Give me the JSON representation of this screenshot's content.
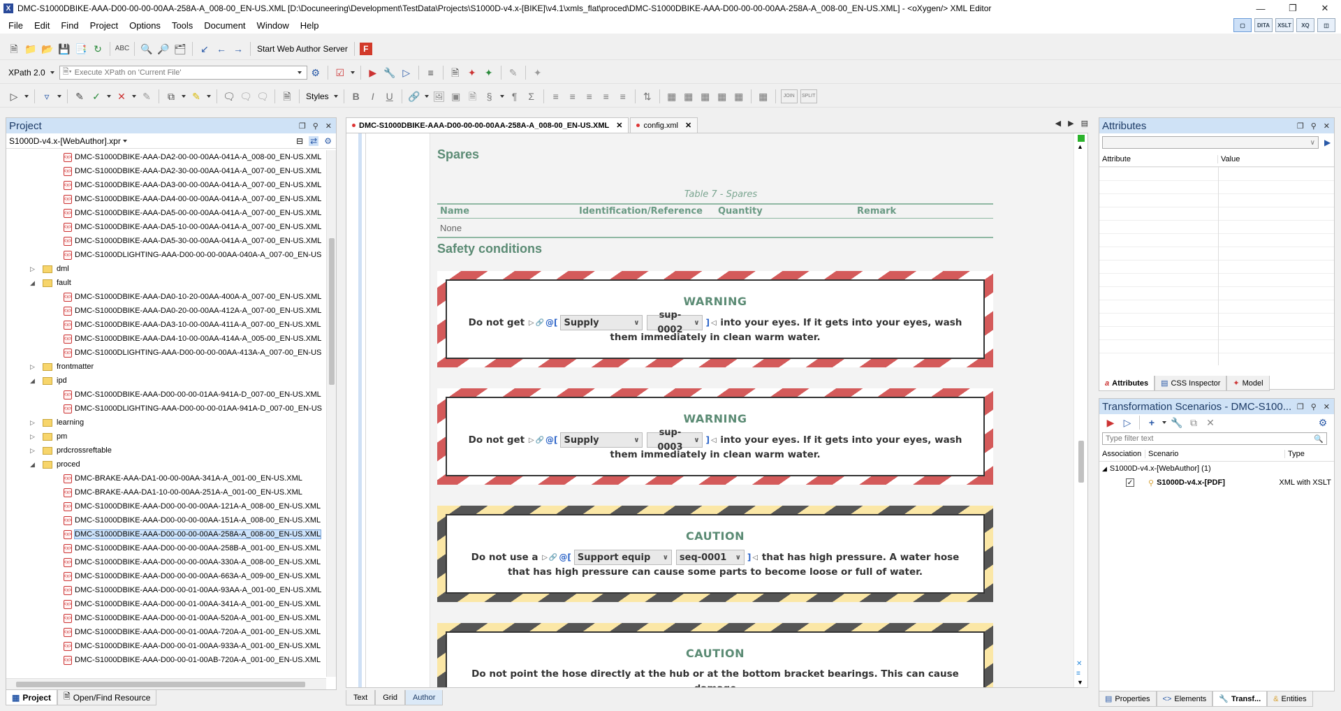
{
  "window": {
    "title": "DMC-S1000DBIKE-AAA-D00-00-00-00AA-258A-A_008-00_EN-US.XML [D:\\Docuneering\\Development\\TestData\\Projects\\S1000D-v4.x-[BIKE]\\v4.1\\xmls_flat\\proced\\DMC-S1000DBIKE-AAA-D00-00-00-00AA-258A-A_008-00_EN-US.XML] - <oXygen/> XML Editor"
  },
  "menu": [
    "File",
    "Edit",
    "Find",
    "Project",
    "Options",
    "Tools",
    "Document",
    "Window",
    "Help"
  ],
  "perspectives": [
    "DITA",
    "XSLT",
    "XQ"
  ],
  "toolbar1": {
    "web_author": "Start Web Author Server"
  },
  "toolbar2": {
    "xpath_version": "XPath 2.0",
    "xpath_placeholder": "Execute XPath on 'Current File'"
  },
  "toolbar3": {
    "styles": "Styles",
    "join": "JOIN",
    "split": "SPLIT"
  },
  "project": {
    "title": "Project",
    "file": "S1000D-v4.x-[WebAuthor].xpr",
    "rows": [
      {
        "type": "file",
        "level": 2,
        "label": "DMC-S1000DBIKE-AAA-DA2-00-00-00AA-041A-A_008-00_EN-US.XML"
      },
      {
        "type": "file",
        "level": 2,
        "label": "DMC-S1000DBIKE-AAA-DA2-30-00-00AA-041A-A_007-00_EN-US.XML"
      },
      {
        "type": "file",
        "level": 2,
        "label": "DMC-S1000DBIKE-AAA-DA3-00-00-00AA-041A-A_007-00_EN-US.XML"
      },
      {
        "type": "file",
        "level": 2,
        "label": "DMC-S1000DBIKE-AAA-DA4-00-00-00AA-041A-A_007-00_EN-US.XML"
      },
      {
        "type": "file",
        "level": 2,
        "label": "DMC-S1000DBIKE-AAA-DA5-00-00-00AA-041A-A_007-00_EN-US.XML"
      },
      {
        "type": "file",
        "level": 2,
        "label": "DMC-S1000DBIKE-AAA-DA5-10-00-00AA-041A-A_007-00_EN-US.XML"
      },
      {
        "type": "file",
        "level": 2,
        "label": "DMC-S1000DBIKE-AAA-DA5-30-00-00AA-041A-A_007-00_EN-US.XML"
      },
      {
        "type": "file",
        "level": 2,
        "label": "DMC-S1000DLIGHTING-AAA-D00-00-00-00AA-040A-A_007-00_EN-US"
      },
      {
        "type": "folder",
        "level": 1,
        "label": "dml",
        "toggle": "▷"
      },
      {
        "type": "folder",
        "level": 1,
        "label": "fault",
        "toggle": "◢"
      },
      {
        "type": "file",
        "level": 2,
        "label": "DMC-S1000DBIKE-AAA-DA0-10-20-00AA-400A-A_007-00_EN-US.XML"
      },
      {
        "type": "file",
        "level": 2,
        "label": "DMC-S1000DBIKE-AAA-DA0-20-00-00AA-412A-A_007-00_EN-US.XML"
      },
      {
        "type": "file",
        "level": 2,
        "label": "DMC-S1000DBIKE-AAA-DA3-10-00-00AA-411A-A_007-00_EN-US.XML"
      },
      {
        "type": "file",
        "level": 2,
        "label": "DMC-S1000DBIKE-AAA-DA4-10-00-00AA-414A-A_005-00_EN-US.XML"
      },
      {
        "type": "file",
        "level": 2,
        "label": "DMC-S1000DLIGHTING-AAA-D00-00-00-00AA-413A-A_007-00_EN-US"
      },
      {
        "type": "folder",
        "level": 1,
        "label": "frontmatter",
        "toggle": "▷"
      },
      {
        "type": "folder",
        "level": 1,
        "label": "ipd",
        "toggle": "◢"
      },
      {
        "type": "file",
        "level": 2,
        "label": "DMC-S1000DBIKE-AAA-D00-00-00-01AA-941A-D_007-00_EN-US.XML"
      },
      {
        "type": "file",
        "level": 2,
        "label": "DMC-S1000DLIGHTING-AAA-D00-00-00-01AA-941A-D_007-00_EN-US"
      },
      {
        "type": "folder",
        "level": 1,
        "label": "learning",
        "toggle": "▷"
      },
      {
        "type": "folder",
        "level": 1,
        "label": "pm",
        "toggle": "▷"
      },
      {
        "type": "folder",
        "level": 1,
        "label": "prdcrossreftable",
        "toggle": "▷"
      },
      {
        "type": "folder",
        "level": 1,
        "label": "proced",
        "toggle": "◢"
      },
      {
        "type": "file",
        "level": 2,
        "label": "DMC-BRAKE-AAA-DA1-00-00-00AA-341A-A_001-00_EN-US.XML"
      },
      {
        "type": "file",
        "level": 2,
        "label": "DMC-BRAKE-AAA-DA1-10-00-00AA-251A-A_001-00_EN-US.XML"
      },
      {
        "type": "file",
        "level": 2,
        "label": "DMC-S1000DBIKE-AAA-D00-00-00-00AA-121A-A_008-00_EN-US.XML"
      },
      {
        "type": "file",
        "level": 2,
        "label": "DMC-S1000DBIKE-AAA-D00-00-00-00AA-151A-A_008-00_EN-US.XML"
      },
      {
        "type": "file",
        "level": 2,
        "label": "DMC-S1000DBIKE-AAA-D00-00-00-00AA-258A-A_008-00_EN-US.XML",
        "selected": true
      },
      {
        "type": "file",
        "level": 2,
        "label": "DMC-S1000DBIKE-AAA-D00-00-00-00AA-258B-A_001-00_EN-US.XML"
      },
      {
        "type": "file",
        "level": 2,
        "label": "DMC-S1000DBIKE-AAA-D00-00-00-00AA-330A-A_008-00_EN-US.XML"
      },
      {
        "type": "file",
        "level": 2,
        "label": "DMC-S1000DBIKE-AAA-D00-00-00-00AA-663A-A_009-00_EN-US.XML"
      },
      {
        "type": "file",
        "level": 2,
        "label": "DMC-S1000DBIKE-AAA-D00-00-01-00AA-93AA-A_001-00_EN-US.XML"
      },
      {
        "type": "file",
        "level": 2,
        "label": "DMC-S1000DBIKE-AAA-D00-00-01-00AA-341A-A_001-00_EN-US.XML"
      },
      {
        "type": "file",
        "level": 2,
        "label": "DMC-S1000DBIKE-AAA-D00-00-01-00AA-520A-A_001-00_EN-US.XML"
      },
      {
        "type": "file",
        "level": 2,
        "label": "DMC-S1000DBIKE-AAA-D00-00-01-00AA-720A-A_001-00_EN-US.XML"
      },
      {
        "type": "file",
        "level": 2,
        "label": "DMC-S1000DBIKE-AAA-D00-00-01-00AA-933A-A_001-00_EN-US.XML"
      },
      {
        "type": "file",
        "level": 2,
        "label": "DMC-S1000DBIKE-AAA-D00-00-01-00AB-720A-A_001-00_EN-US.XML"
      }
    ],
    "tabs": [
      "Project",
      "Open/Find Resource"
    ]
  },
  "editor": {
    "tabs": [
      {
        "label": "DMC-S1000DBIKE-AAA-D00-00-00-00AA-258A-A_008-00_EN-US.XML",
        "active": true
      },
      {
        "label": "config.xml",
        "active": false
      }
    ],
    "spares_heading": "Spares",
    "table_caption": "Table 7 - Spares",
    "table_columns": [
      "Name",
      "Identification/Reference",
      "Quantity",
      "Remark"
    ],
    "table_none": "None",
    "safety_heading": "Safety conditions",
    "warnings": [
      {
        "title": "WARNING",
        "pre": "Do not get",
        "select1": "Supply",
        "select2": "sup-0002",
        "post": "into your eyes. If it gets into your eyes, wash them immediately in clean warm water."
      },
      {
        "title": "WARNING",
        "pre": "Do not get",
        "select1": "Supply",
        "select2": "sup-0003",
        "post": "into your eyes. If it gets into your eyes, wash them immediately in clean warm water."
      }
    ],
    "cautions": [
      {
        "title": "CAUTION",
        "pre": "Do not use a",
        "select1": "Support equip",
        "select2": "seq-0001",
        "post": "that has high pressure. A water hose that has high pressure can cause some parts to become loose or full of water."
      },
      {
        "title": "CAUTION",
        "pre": "",
        "select1": "",
        "select2": "",
        "post": "Do not point the hose directly at the hub or at the bottom bracket bearings. This can cause damage"
      }
    ],
    "mode_tabs": [
      "Text",
      "Grid",
      "Author"
    ],
    "active_mode": "Author"
  },
  "attributes": {
    "title": "Attributes",
    "col_attribute": "Attribute",
    "col_value": "Value",
    "tabs": [
      "Attributes",
      "CSS Inspector",
      "Model"
    ]
  },
  "transform": {
    "title": "Transformation Scenarios - DMC-S100...",
    "filter_placeholder": "Type filter text",
    "col_assoc": "Association",
    "col_scenario": "Scenario",
    "col_type": "Type",
    "group": "S1000D-v4.x-[WebAuthor] (1)",
    "scenario": "S1000D-v4.x-[PDF]",
    "scenario_type": "XML with XSLT"
  },
  "right_tabs": [
    "Properties",
    "Elements",
    "Transf...",
    "Entities"
  ]
}
